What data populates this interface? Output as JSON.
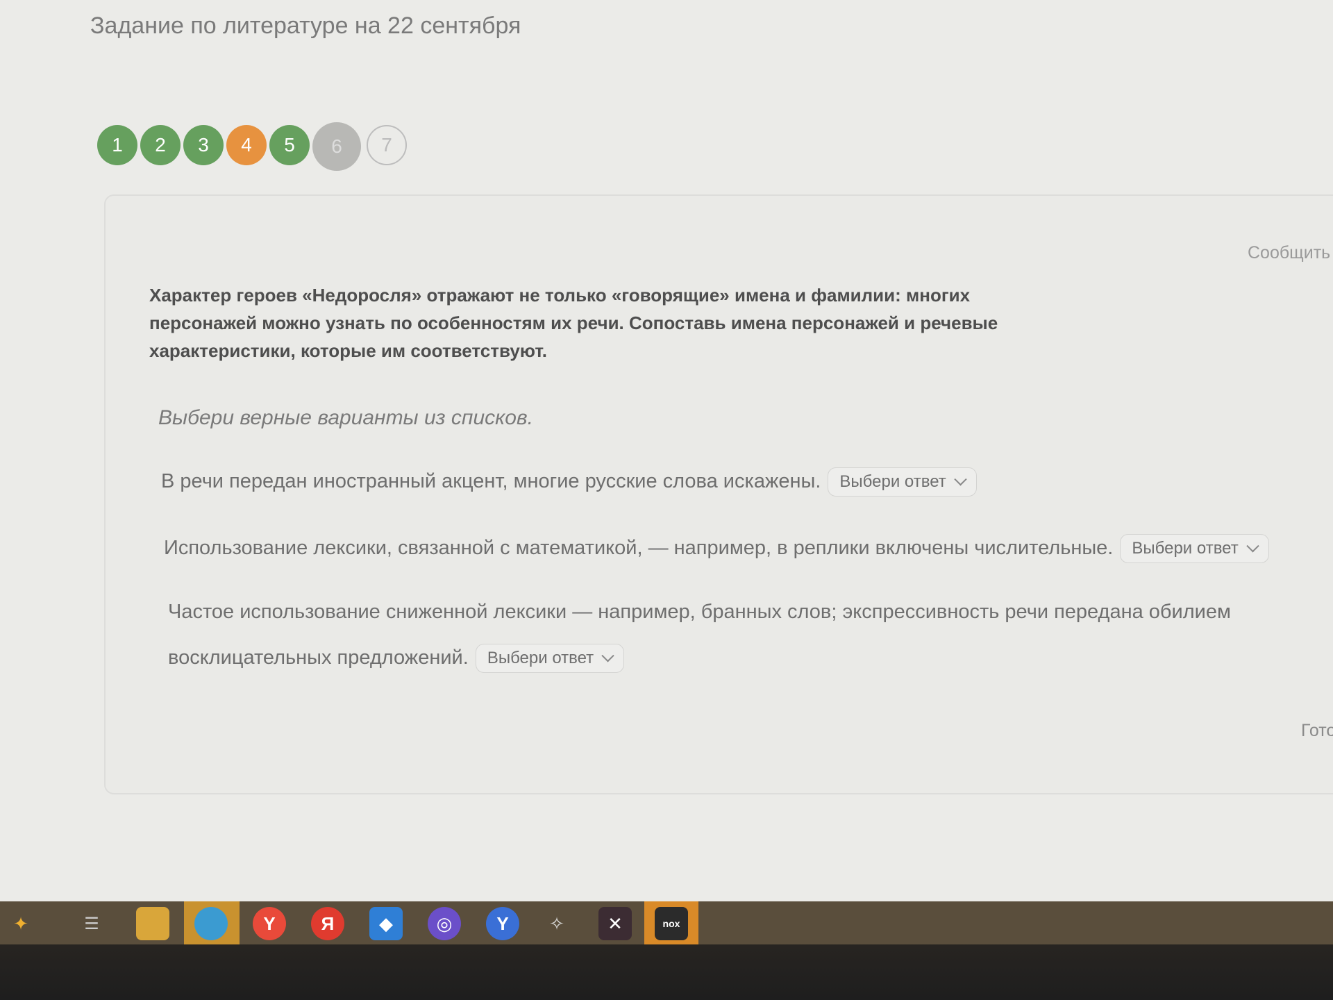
{
  "page": {
    "title": "Задание по литературе на 22 сентября"
  },
  "steps": [
    {
      "label": "1",
      "state": "correct"
    },
    {
      "label": "2",
      "state": "correct"
    },
    {
      "label": "3",
      "state": "correct"
    },
    {
      "label": "4",
      "state": "partial"
    },
    {
      "label": "5",
      "state": "correct"
    },
    {
      "label": "6",
      "state": "current"
    },
    {
      "label": "7",
      "state": "unanswered"
    }
  ],
  "card": {
    "report_label": "Сообщить",
    "question": "Характер героев «Недоросля» отражают не только «говорящие» имена и фамилии: многих персонажей можно узнать по особенностям их речи. Сопоставь имена персонажей и речевые характеристики, которые им соответствуют.",
    "instruction": "Выбери верные варианты из списков.",
    "statements": [
      {
        "text": "В речи передан иностранный акцент, многие русские слова искажены.",
        "select_value": "Выбери ответ"
      },
      {
        "text": "Использование лексики, связанной с математикой, — например, в реплики включены числительные.",
        "select_value": "Выбери ответ"
      },
      {
        "text": "Частое использование сниженной лексики — например, бранных слов; экспрессивность речи передана обилием восклицательных предложений.",
        "select_value": "Выбери ответ"
      }
    ],
    "done_label": "Гото"
  },
  "taskbar": {
    "icons": [
      "start-icon",
      "task-view-icon",
      "file-explorer-icon",
      "edge-icon",
      "yandex-browser-icon",
      "yandex-icon",
      "store-icon",
      "game-icon",
      "yandex-y-icon",
      "app-icon",
      "app-dark-icon",
      "nox-icon"
    ]
  },
  "colors": {
    "correct": "#66a05e",
    "partial": "#e7923f",
    "current": "#b8b8b5"
  }
}
